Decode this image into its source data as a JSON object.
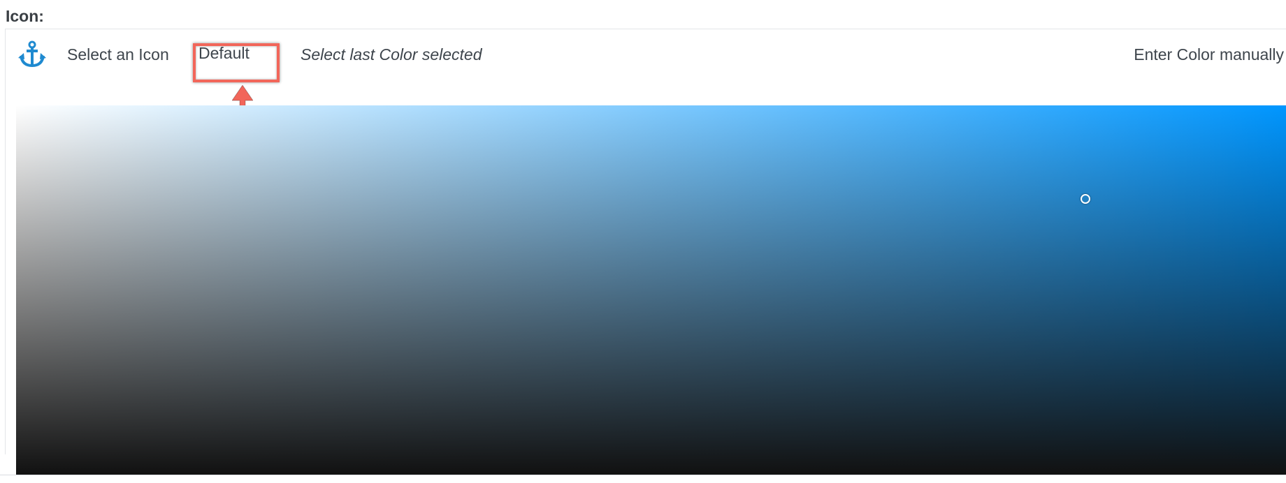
{
  "section": {
    "label": "Icon:"
  },
  "toolbar": {
    "icon_name": "anchor-icon",
    "select_icon_label": "Select an Icon",
    "default_label": "Default",
    "last_color_label": "Select last Color selected",
    "manual_label": "Enter Color manually"
  },
  "colors": {
    "accent": "#1f8ad0",
    "hue": "#0096ff",
    "annotation": "#f2665a",
    "text": "#3e454c"
  },
  "annotation": {
    "highlight_target": "Default"
  }
}
